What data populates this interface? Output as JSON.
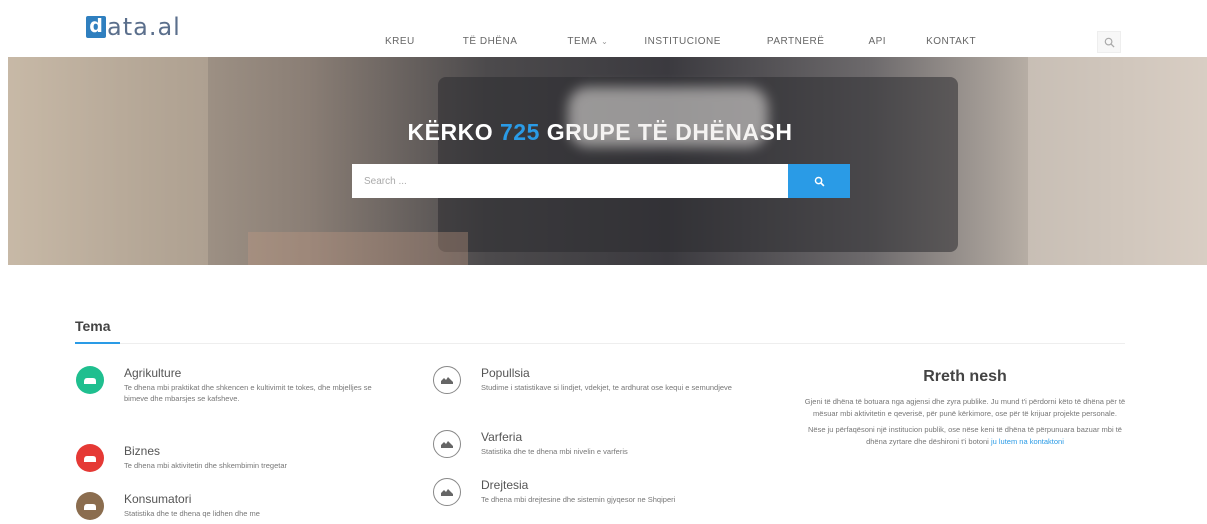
{
  "header": {
    "logo_letter": "d",
    "logo_text": "ata.al",
    "nav": [
      {
        "label": "KREU"
      },
      {
        "label": "TË DHËNA"
      },
      {
        "label": "TEMA",
        "has_dropdown": true
      },
      {
        "label": "INSTITUCIONE"
      },
      {
        "label": "PARTNERË"
      },
      {
        "label": "API"
      },
      {
        "label": "KONTAKT"
      }
    ],
    "search_icon": "search-icon"
  },
  "hero": {
    "title_prefix": "KËRKO",
    "count": "725",
    "title_suffix": "GRUPE TË DHËNASH",
    "search_placeholder": "Search ...",
    "search_icon": "search-icon"
  },
  "topics": {
    "heading": "Tema",
    "items": [
      {
        "title": "Agrikulture",
        "description": "Te dhena mbi praktikat dhe shkencen e kultivimit te tokes, dhe mbjelljes se bimeve dhe mbarsjes se kafsheve.",
        "icon": "cow-icon",
        "color": "#1fbf8f"
      },
      {
        "title": "Biznes",
        "description": "Te dhena mbi aktivitetin dhe shkembimin tregetar",
        "icon": "briefcase-icon",
        "color": "#e53935"
      },
      {
        "title": "Konsumatori",
        "description": "Statistika dhe te dhena qe lidhen dhe me",
        "icon": "basket-icon",
        "color": "#8b6d4f"
      },
      {
        "title": "Popullsia",
        "description": "Studime i statistikave si lindjet, vdekjet, te ardhurat ose kequi e semundjeve",
        "icon": "people-icon",
        "color": "#888888"
      },
      {
        "title": "Varferia",
        "description": "Statistika dhe te dhena mbi nivelin e varferis",
        "icon": "coins-icon",
        "color": "#888888"
      },
      {
        "title": "Drejtesia",
        "description": "Te dhena mbi drejtesine dhe sistemin gjyqesor ne Shqiperi",
        "icon": "scales-icon",
        "color": "#888888"
      }
    ]
  },
  "about": {
    "title": "Rreth nesh",
    "paragraph1": "Gjeni të dhëna të botuara nga agjensi dhe zyra publike. Ju mund t'i përdorni këto të dhëna për të mësuar mbi aktivitetin e qeverisë, për punë kërkimore, ose për të krijuar projekte personale.",
    "paragraph2_text": "Nëse ju përfaqësoni një institucion publik, ose nëse keni të dhëna të përpunuara bazuar mbi të dhëna zyrtare dhe dëshironi t'i botoni",
    "paragraph2_link": "ju lutem na kontaktoni"
  },
  "colors": {
    "accent": "#2a9be6",
    "logo": "#2f7fbf"
  }
}
